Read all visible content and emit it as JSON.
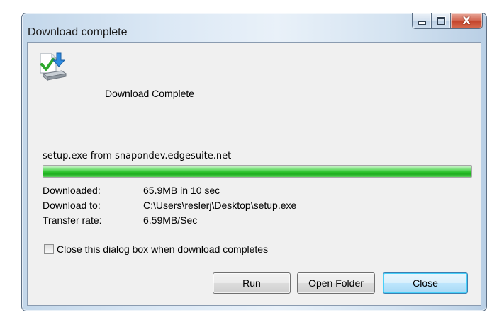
{
  "window": {
    "title": "Download complete",
    "caption_buttons": {
      "minimize_icon": "minimize-icon",
      "maximize_icon": "maximize-icon",
      "close_icon": "close-icon",
      "close_glyph": "X"
    }
  },
  "header": {
    "icon": "download-complete-icon",
    "title": "Download Complete"
  },
  "download": {
    "source": "setup.exe from snapondev.edgesuite.net",
    "progress": 1.0,
    "details": [
      {
        "label": "Downloaded:",
        "value": "65.9MB in 10 sec"
      },
      {
        "label": "Download to:",
        "value": "C:\\Users\\reslerj\\Desktop\\setup.exe"
      },
      {
        "label": "Transfer rate:",
        "value": "6.59MB/Sec"
      }
    ]
  },
  "options": {
    "close_when_complete_label": "Close this dialog box when download completes",
    "close_when_complete_checked": false
  },
  "buttons": {
    "run": "Run",
    "open_folder": "Open Folder",
    "close": "Close"
  },
  "colors": {
    "progress_green": "#2fc42f",
    "default_button_border": "#3c7fb1",
    "close_caption_red": "#c3432a"
  }
}
